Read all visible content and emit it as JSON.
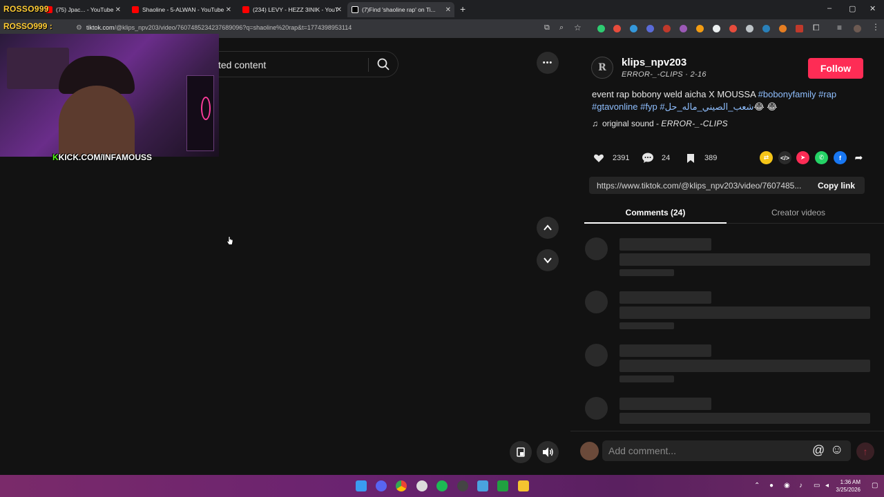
{
  "browser": {
    "tabs": [
      {
        "title": "(75) Jpac... - YouTube",
        "favicon": "youtube-favicon"
      },
      {
        "title": "Shaoline - 5-ALWAN - YouTube",
        "favicon": "youtube-favicon"
      },
      {
        "title": "(234) LEVY - HEZZ 3INIK - YouT",
        "favicon": "youtube-favicon"
      },
      {
        "title": "(7)Find 'shaoline rap' on Ti...",
        "favicon": "tiktok-favicon"
      }
    ],
    "new_tab": "+",
    "window_controls": [
      "–",
      "▢",
      "✕"
    ],
    "url_domain": "tiktok.com",
    "url_path": "/@klips_npv203/video/7607485234237689096?q=shaoline%20rap&t=1774398953114"
  },
  "overlay": {
    "watermark": "ROSSO999",
    "watermark_second": "ROSSO999 :",
    "kick_k": "K",
    "kick_text": "KICK.COM/INFAMOUSS"
  },
  "search": {
    "visible_text": "ted content"
  },
  "video_controls": {
    "more": "•••"
  },
  "post": {
    "avatar_letter": "R",
    "username": "klips_npv203",
    "nickname": "ERROR-_-CLIPS",
    "separator": " · ",
    "date": "2-16",
    "follow_label": "Follow",
    "desc_plain": "event rap bobony weld aicha X MOUSSA ",
    "desc_tags": [
      "#bobonyfamily",
      "#rap",
      "#gtavonline",
      "#fyp",
      "#شعب_الصيني_ماله_حل"
    ],
    "desc_emoji": "😂 😂",
    "sound_prefix": "original sound - ",
    "sound_author": "ERROR-_-CLIPS",
    "likes": "2391",
    "comments": "24",
    "saves": "389",
    "link": "https://www.tiktok.com/@klips_npv203/video/7607485...",
    "copy_link_label": "Copy link"
  },
  "panel_tabs": {
    "comments": "Comments (24)",
    "creator_videos": "Creator videos"
  },
  "comment_box": {
    "placeholder": "Add comment...",
    "mention": "@",
    "emoji": "☺"
  },
  "taskbar": {
    "time": "1:36 AM",
    "date": "3/25/2026"
  },
  "colors": {
    "follow": "#fe2c55",
    "hashtag": "#8fbfff",
    "taskbar": "#6a2370"
  }
}
